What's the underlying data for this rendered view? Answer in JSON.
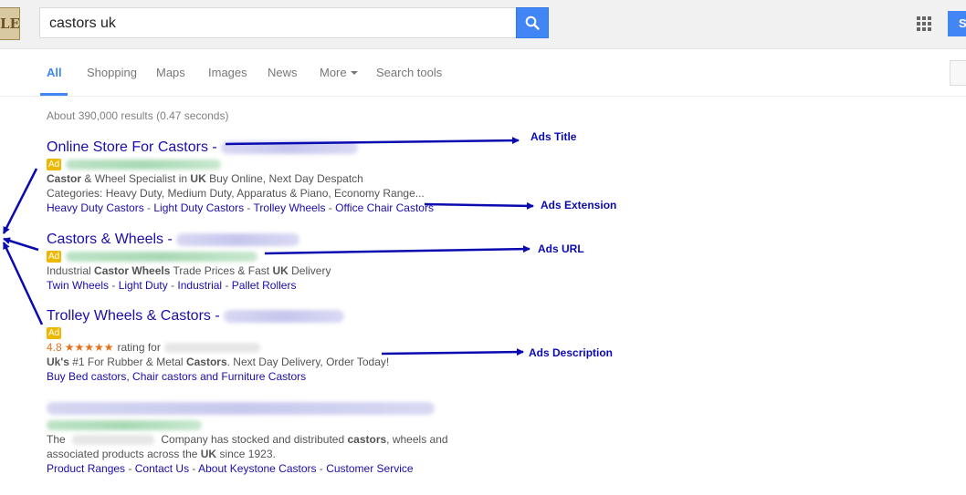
{
  "search": {
    "query": "castors uk"
  },
  "header": {
    "logo_text": "LE",
    "signin_label": "S"
  },
  "tabs": [
    {
      "label": "All"
    },
    {
      "label": "Shopping"
    },
    {
      "label": "Maps"
    },
    {
      "label": "Images"
    },
    {
      "label": "News"
    },
    {
      "label": "More"
    },
    {
      "label": "Search tools"
    }
  ],
  "stats": "About 390,000 results (0.47 seconds)",
  "ad_badge": "Ad",
  "results": [
    {
      "title": "Online Store For Castors -",
      "desc1_parts": [
        "Castor",
        " & Wheel Specialist in ",
        "UK",
        " Buy Online, Next Day Despatch"
      ],
      "desc2": "Categories: Heavy Duty, Medium Duty, Apparatus & Piano, Economy Range...",
      "links": [
        "Heavy Duty Castors",
        "Light Duty Castors",
        "Trolley Wheels",
        "Office Chair Castors"
      ]
    },
    {
      "title": "Castors & Wheels -",
      "desc1_parts": [
        "Industrial ",
        "Castor Wheels",
        " Trade Prices & Fast ",
        "UK",
        " Delivery"
      ],
      "links": [
        "Twin Wheels",
        "Light Duty",
        "Industrial",
        "Pallet Rollers"
      ]
    },
    {
      "title": "Trolley Wheels & Castors -",
      "rating_value": "4.8",
      "rating_stars": "★★★★★",
      "rating_text": "rating for",
      "desc1_parts": [
        "Uk's",
        " #1 For Rubber & Metal ",
        "Castors",
        ". Next Day Delivery, Order Today!"
      ],
      "links_text": "Buy Bed castors, Chair castors and Furniture Castors"
    },
    {
      "desc1_parts": [
        "The ",
        " Company has stocked and distributed ",
        "castors",
        ", wheels and"
      ],
      "desc2_parts": [
        "associated products across the ",
        "UK",
        " since 1923."
      ],
      "links": [
        "Product Ranges",
        "Contact Us",
        "About Keystone Castors",
        "Customer Service"
      ]
    }
  ],
  "annotations": {
    "title": "Ads Title",
    "extension": "Ads Extension",
    "url": "Ads URL",
    "description": "Ads Description"
  },
  "colors": {
    "accent": "#4285f4",
    "link": "#1a0dab",
    "ad_badge": "#edb802",
    "annotation": "#0a0ab0"
  }
}
